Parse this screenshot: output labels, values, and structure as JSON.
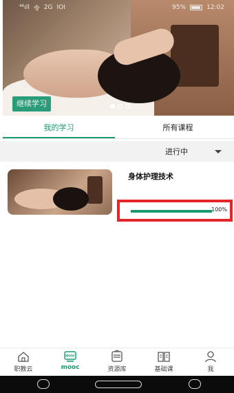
{
  "statusbar": {
    "signal": "⁴⁶ıll",
    "wifi": "令",
    "network": "2G",
    "sim": "IOI",
    "battery_pct": "95%",
    "time": "12:02"
  },
  "banner": {
    "continue_label": "继续学习",
    "slide_count": 3,
    "active_slide": 0
  },
  "tabs": [
    {
      "label": "我的学习",
      "active": true
    },
    {
      "label": "所有课程",
      "active": false
    }
  ],
  "filter": {
    "selected": "进行中"
  },
  "courses": [
    {
      "title": "身体护理技术",
      "progress": 1.0,
      "progress_label": "100%"
    }
  ],
  "bottom_nav": [
    {
      "label": "职教云",
      "icon": "home-icon",
      "active": false
    },
    {
      "label": "mooc",
      "icon": "mooc-icon",
      "active": true
    },
    {
      "label": "资源库",
      "icon": "library-icon",
      "active": false
    },
    {
      "label": "基础课",
      "icon": "book-icon",
      "active": false
    },
    {
      "label": "我",
      "icon": "user-icon",
      "active": false
    }
  ],
  "colors": {
    "accent": "#1a9a72",
    "highlight_box": "#e2262a"
  }
}
